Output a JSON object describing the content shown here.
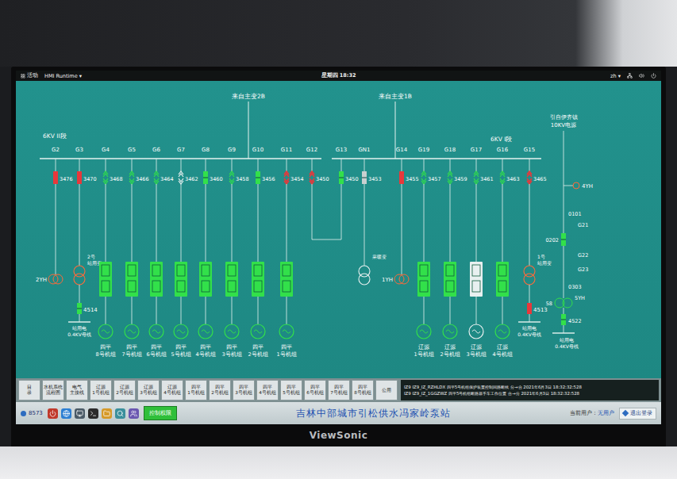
{
  "top_bar": {
    "activities": "活动",
    "app": "HMI Runtime ▾",
    "clock": "星期四 18:32",
    "language": "zh ▾"
  },
  "diagram": {
    "sources": [
      {
        "label": "来自主变2B"
      },
      {
        "label": "来自主变1B"
      }
    ],
    "buses": [
      {
        "label": "6KV II段",
        "bays": [
          {
            "name": "G2",
            "breaker": "3476",
            "kind": "breaker",
            "closed": true,
            "color": "#e8383b",
            "load": {
              "kind": "vt",
              "label": "2YH"
            }
          },
          {
            "name": "G3",
            "breaker": "3470",
            "kind": "breaker",
            "closed": true,
            "color": "#e8383b",
            "load": {
              "kind": "transformer",
              "lines": [
                "2号",
                "站用变"
              ],
              "color": "#ff6a3a",
              "switch": {
                "number": "4514",
                "closed": false,
                "color": "#32e04a"
              },
              "bus": [
                "站用电",
                "0.4KV母线"
              ]
            }
          },
          {
            "name": "G4",
            "breaker": "3468",
            "kind": "cart",
            "closed": false,
            "color": "#32e04a",
            "load": {
              "kind": "unit",
              "lines": [
                "四平",
                "8号机组"
              ],
              "color": "#32e04a"
            }
          },
          {
            "name": "G5",
            "breaker": "3466",
            "kind": "cart",
            "closed": false,
            "color": "#32e04a",
            "load": {
              "kind": "unit",
              "lines": [
                "四平",
                "7号机组"
              ],
              "color": "#32e04a"
            }
          },
          {
            "name": "G6",
            "breaker": "3464",
            "kind": "cart",
            "closed": false,
            "color": "#32e04a",
            "load": {
              "kind": "unit",
              "lines": [
                "四平",
                "6号机组"
              ],
              "color": "#32e04a"
            }
          },
          {
            "name": "G7",
            "breaker": "3462",
            "kind": "cart",
            "closed": false,
            "color": "#e8f0f0",
            "load": {
              "kind": "unit",
              "lines": [
                "四平",
                "5号机组"
              ],
              "color": "#32e04a"
            }
          },
          {
            "name": "G8",
            "breaker": "3460",
            "kind": "breaker",
            "closed": false,
            "color": "#32e04a",
            "load": {
              "kind": "unit",
              "lines": [
                "四平",
                "4号机组"
              ],
              "color": "#32e04a"
            }
          },
          {
            "name": "G9",
            "breaker": "3458",
            "kind": "cart",
            "closed": false,
            "color": "#32e04a",
            "load": {
              "kind": "unit",
              "lines": [
                "四平",
                "3号机组"
              ],
              "color": "#32e04a"
            }
          },
          {
            "name": "G10",
            "breaker": "3456",
            "kind": "breaker",
            "closed": false,
            "color": "#32e04a",
            "load": {
              "kind": "unit",
              "lines": [
                "四平",
                "2号机组"
              ],
              "color": "#32e04a"
            }
          },
          {
            "name": "G11",
            "breaker": "3454",
            "kind": "cart",
            "closed": true,
            "color": "#e8383b",
            "load": {
              "kind": "unit",
              "lines": [
                "四平",
                "1号机组"
              ],
              "color": "#32e04a"
            }
          },
          {
            "name": "G12",
            "breaker": "3450",
            "kind": "cart",
            "closed": true,
            "color": "#e8383b",
            "load": {
              "kind": "tie"
            }
          }
        ]
      },
      {
        "label": "6KV I段",
        "bays": [
          {
            "name": "G13",
            "breaker": "3450",
            "kind": "breaker",
            "closed": false,
            "color": "#32e04a",
            "load": {
              "kind": "tie"
            }
          },
          {
            "name": "GN1",
            "breaker": "3453",
            "kind": "breaker",
            "closed": false,
            "color": "#c8d0d0",
            "load": {
              "kind": "transformer",
              "lines": [
                "采暖变"
              ],
              "color": "#e8f0f0"
            }
          },
          {
            "name": "G14",
            "breaker": "3455",
            "kind": "breaker",
            "closed": true,
            "color": "#e8383b",
            "load": {
              "kind": "vt",
              "label": "1YH"
            }
          },
          {
            "name": "G19",
            "breaker": "3457",
            "kind": "cart",
            "closed": false,
            "color": "#32e04a",
            "load": {
              "kind": "unit",
              "lines": [
                "辽源",
                "1号机组"
              ],
              "color": "#32e04a"
            }
          },
          {
            "name": "G18",
            "breaker": "3459",
            "kind": "cart",
            "closed": false,
            "color": "#32e04a",
            "load": {
              "kind": "unit",
              "lines": [
                "辽源",
                "2号机组"
              ],
              "color": "#32e04a"
            }
          },
          {
            "name": "G17",
            "breaker": "3461",
            "kind": "cart",
            "closed": false,
            "color": "#32e04a",
            "load": {
              "kind": "unit",
              "lines": [
                "辽源",
                "3号机组"
              ],
              "color": "#e8f0f0"
            }
          },
          {
            "name": "G16",
            "breaker": "3463",
            "kind": "cart",
            "closed": false,
            "color": "#32e04a",
            "load": {
              "kind": "unit",
              "lines": [
                "辽源",
                "4号机组"
              ],
              "color": "#32e04a"
            }
          },
          {
            "name": "G15",
            "breaker": "3465",
            "kind": "cart",
            "closed": true,
            "color": "#e8383b",
            "load": {
              "kind": "transformer",
              "lines": [
                "1号",
                "站用变"
              ],
              "color": "#ff6a3a",
              "switch": {
                "number": "4513",
                "closed": true,
                "color": "#e8383b"
              },
              "bus": [
                "站用电",
                "0.4KV母线"
              ]
            }
          }
        ]
      }
    ],
    "external": {
      "source": [
        "引自伊齐镇",
        "10KV电源"
      ],
      "vt": "4YH",
      "labels": [
        "0101",
        "G21",
        "G22",
        "G23",
        "0303"
      ],
      "breaker": {
        "number": "0202",
        "closed": false,
        "color": "#32e04a"
      },
      "transformer": {
        "label": "5YH",
        "number": "58",
        "color": "#32e04a"
      },
      "switch": {
        "number": "4522",
        "closed": false,
        "color": "#32e04a"
      },
      "bus": [
        "站用电",
        "0.4KV母线"
      ]
    }
  },
  "nav": {
    "buttons": [
      {
        "lines": [
          "目",
          "录"
        ],
        "selected": false
      },
      {
        "lines": [
          "水机系统",
          "流程图"
        ],
        "selected": false
      },
      {
        "lines": [
          "电气",
          "主接线"
        ],
        "selected": false
      },
      {
        "lines": [
          "辽源",
          "1号机组"
        ],
        "selected": false
      },
      {
        "lines": [
          "辽源",
          "2号机组"
        ],
        "selected": false
      },
      {
        "lines": [
          "辽源",
          "3号机组"
        ],
        "selected": false
      },
      {
        "lines": [
          "辽源",
          "4号机组"
        ],
        "selected": false
      },
      {
        "lines": [
          "四平",
          "1号机组"
        ],
        "selected": false
      },
      {
        "lines": [
          "四平",
          "2号机组"
        ],
        "selected": false
      },
      {
        "lines": [
          "四平",
          "3号机组"
        ],
        "selected": false
      },
      {
        "lines": [
          "四平",
          "4号机组"
        ],
        "selected": false
      },
      {
        "lines": [
          "四平",
          "5号机组"
        ],
        "selected": false
      },
      {
        "lines": [
          "四平",
          "6号机组"
        ],
        "selected": false
      },
      {
        "lines": [
          "四平",
          "7号机组"
        ],
        "selected": false
      },
      {
        "lines": [
          "四平",
          "8号机组"
        ],
        "selected": false
      },
      {
        "lines": [
          "公用"
        ],
        "selected": false
      }
    ],
    "log": [
      "IZ9 IZ9_IZ_RZHLDX 四平5号机组保护装置控制回路断线 分→合 2021年6月3日 18:32:32:528",
      "IZ9 IZ9_IZ_1GGZWZ 四平5号机组断路器手车工作位置 合→分 2021年6月3日 18:32:32:528"
    ]
  },
  "status_bar": {
    "counter": "8573",
    "control_button": "控制权限",
    "title": "吉林中部城市引松供水冯家岭泵站",
    "user_label": "当前用户：",
    "user": "无用户",
    "logout": "退出登录"
  },
  "monitor": {
    "brand": "ViewSonic"
  }
}
